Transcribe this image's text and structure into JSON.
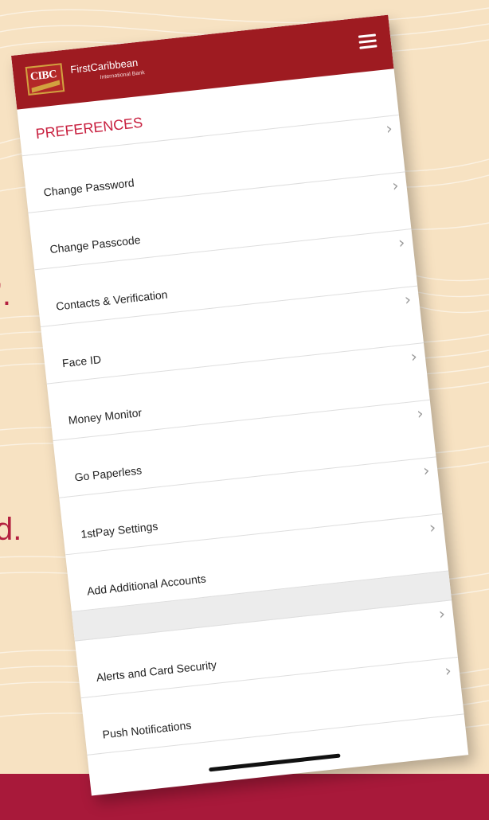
{
  "colors": {
    "background": "#f7e2c2",
    "band": "#a8193a",
    "header": "#9e1b21",
    "accent": "#c8203f"
  },
  "background_text": [
    "’.",
    "d."
  ],
  "app": {
    "logo_text": "CIBC",
    "brand_name": "FirstCaribbean",
    "brand_sub": "International Bank",
    "menu_icon": "hamburger-icon"
  },
  "preferences": {
    "title": "PREFERENCES",
    "items": [
      {
        "label": "Change Password"
      },
      {
        "label": "Change Passcode"
      },
      {
        "label": "Contacts & Verification"
      },
      {
        "label": "Face ID"
      },
      {
        "label": "Money Monitor"
      },
      {
        "label": "Go Paperless"
      },
      {
        "label": "1stPay Settings"
      },
      {
        "label": "Add Additional Accounts"
      }
    ],
    "second_group": [
      {
        "label": "Alerts and Card Security"
      },
      {
        "label": "Push Notifications"
      }
    ],
    "chevron": "›"
  }
}
